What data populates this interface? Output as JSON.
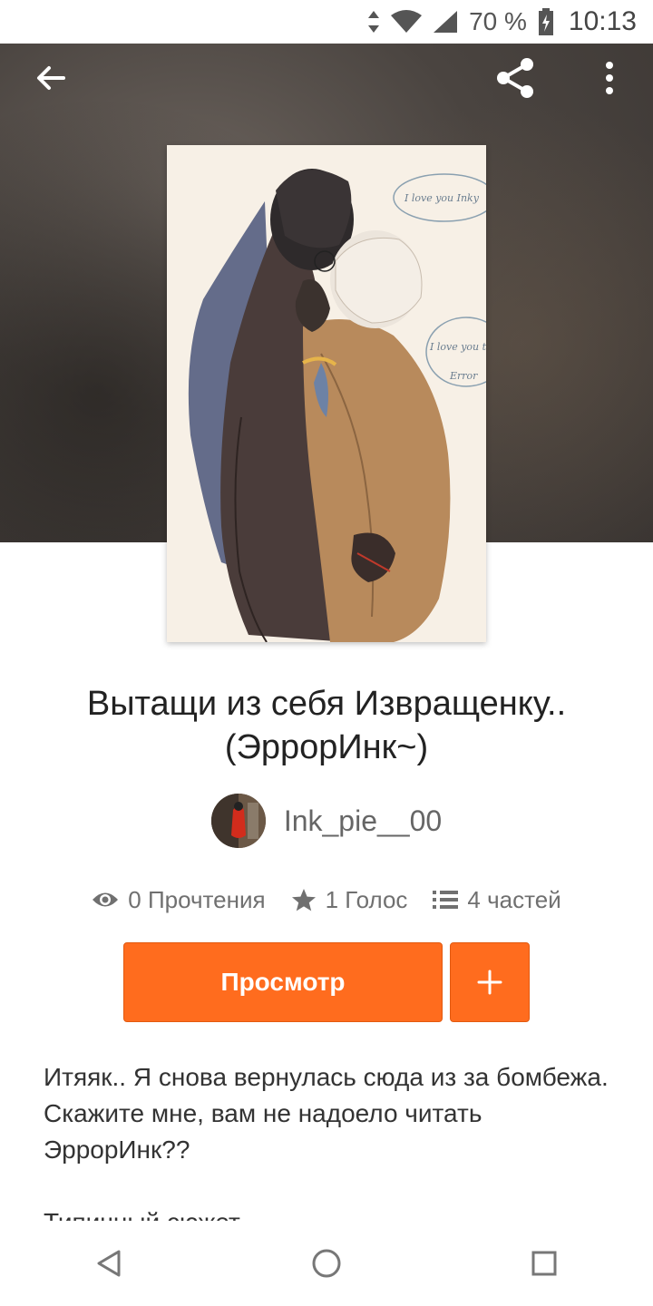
{
  "status_bar": {
    "battery_percent": "70 %",
    "time": "10:13",
    "icons": [
      "data-arrows-icon",
      "wifi-icon",
      "signal-icon",
      "battery-charging-icon"
    ]
  },
  "header": {
    "back_icon": "arrow-left-icon",
    "share_icon": "share-icon",
    "more_icon": "more-vertical-icon"
  },
  "cover": {
    "bubble_1": "I love you Inky",
    "bubble_2a": "I love you t",
    "bubble_2b": "Error"
  },
  "story": {
    "title": "Вытащи из себя Извращенку.. (ЭррорИнк~)",
    "author": "Ink_pie__00"
  },
  "stats": {
    "reads": "0 Прочтения",
    "votes": "1 Голос",
    "parts": "4 частей"
  },
  "actions": {
    "read_label": "Просмотр",
    "add_label": "+"
  },
  "description": {
    "paragraph_1": "Итяяк.. Я снова вернулась сюда из за бомбежа. Скажите мне, вам не надоело читать ЭррорИнк??",
    "paragraph_2": "Типичный сюжет"
  },
  "colors": {
    "accent": "#ff6c1e",
    "hero_bg": "#4a4440"
  },
  "nav_bar": {
    "back": "triangle-back-icon",
    "home": "circle-home-icon",
    "recents": "square-recents-icon"
  }
}
